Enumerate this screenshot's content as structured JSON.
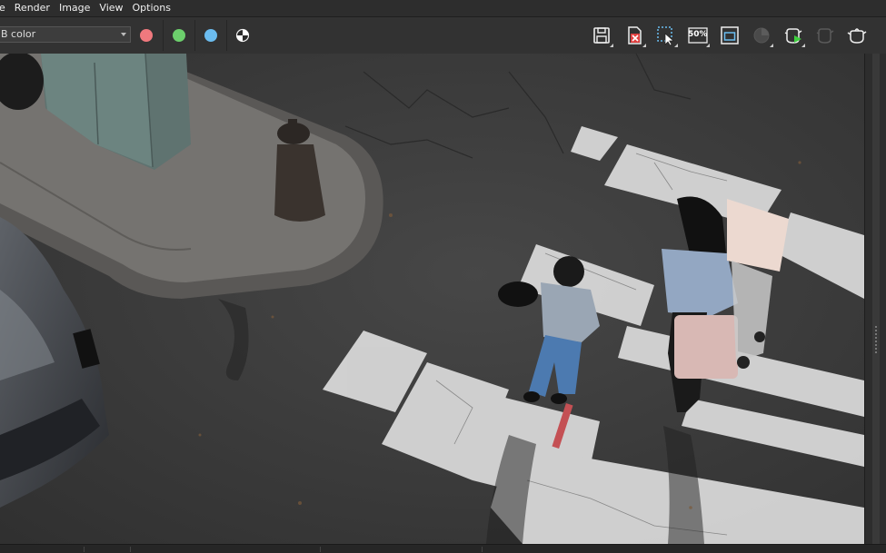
{
  "menu": {
    "items": [
      {
        "label": "e"
      },
      {
        "label": "Render"
      },
      {
        "label": "Image"
      },
      {
        "label": "View"
      },
      {
        "label": "Options"
      }
    ]
  },
  "toolbar": {
    "channel_combo": {
      "value": "B color"
    },
    "channels": [
      {
        "name": "red-channel",
        "color": "#f0797e"
      },
      {
        "name": "green-channel",
        "color": "#6ccf6c"
      },
      {
        "name": "blue-channel",
        "color": "#6bbcef"
      },
      {
        "name": "alpha-channel",
        "color": "#ffffff"
      }
    ],
    "zoom_label": "50%",
    "buttons": [
      {
        "icon": "save-icon"
      },
      {
        "icon": "clear-image-icon"
      },
      {
        "icon": "region-select-icon"
      },
      {
        "icon": "zoom-icon"
      },
      {
        "icon": "fit-window-icon"
      },
      {
        "icon": "display-correction-icon"
      },
      {
        "icon": "start-render-icon"
      },
      {
        "icon": "stop-render-icon"
      },
      {
        "icon": "teapot-icon"
      }
    ]
  },
  "colors": {
    "background": "#2b2b2b",
    "toolbar": "#323232",
    "asphalt": "#3a3a3a",
    "crosswalk_paint": "#e8e8e8"
  }
}
